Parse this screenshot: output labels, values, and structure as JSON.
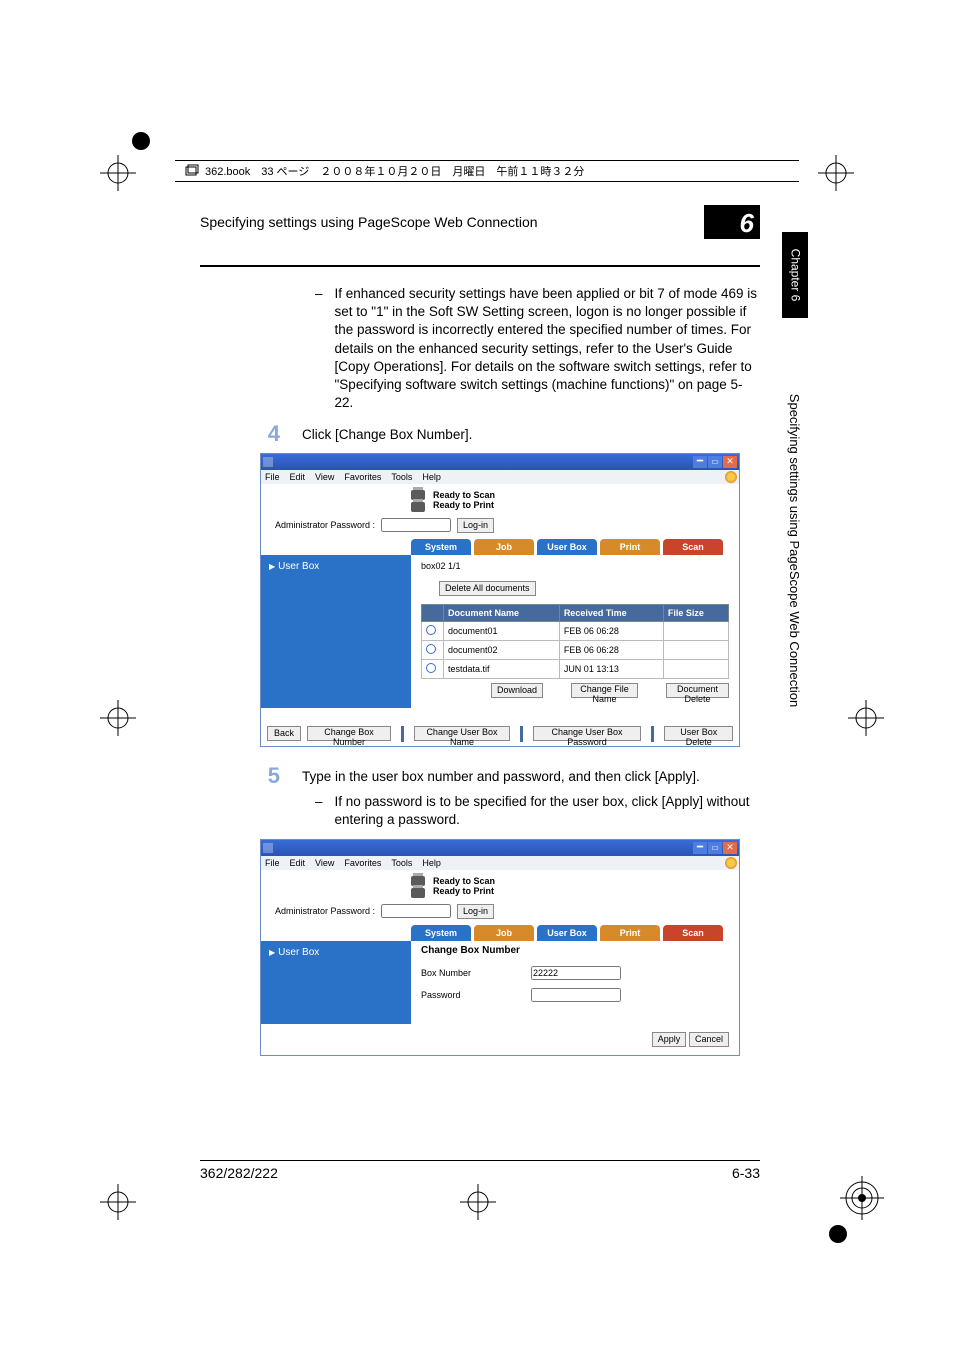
{
  "header_strip": "362.book　33 ページ　２００８年１０月２０日　月曜日　午前１１時３２分",
  "running_head": "Specifying settings using PageScope Web Connection",
  "chapter_number": "6",
  "side_chapter_label": "Chapter 6",
  "side_vertical_text": "Specifying settings using PageScope Web Connection",
  "para_bullet1": "If enhanced security settings have been applied or bit 7 of mode 469 is set to \"1\" in the Soft SW Setting screen, logon is no longer possible if the password is incorrectly entered the specified number of times. For details on the enhanced security settings, refer to the User's Guide [Copy Operations]. For details on the software switch settings, refer to \"Specifying software switch settings (machine functions)\" on page 5-22.",
  "step4_num": "4",
  "step4_text": "Click [Change Box Number].",
  "step5_num": "5",
  "step5_text": "Type in the user box number and password, and then click [Apply].",
  "step5_bullet": "If no password is to be specified for the user box, click [Apply] without entering a password.",
  "win": {
    "menus": [
      "File",
      "Edit",
      "View",
      "Favorites",
      "Tools",
      "Help"
    ],
    "status1": "Ready to Scan",
    "status2": "Ready to Print",
    "admin_label": "Administrator Password :",
    "login_btn": "Log-in",
    "tabs": {
      "system": "System",
      "job": "Job",
      "userbox": "User Box",
      "print": "Print",
      "scan": "Scan"
    },
    "sidebar_item": "User Box",
    "box_info": "box02  1/1",
    "delete_all_btn": "Delete All documents",
    "table": {
      "headers": [
        "",
        "Document Name",
        "Received Time",
        "File Size"
      ],
      "rows": [
        {
          "name": "document01",
          "time": "FEB 06 06:28",
          "size": ""
        },
        {
          "name": "document02",
          "time": "FEB 06 06:28",
          "size": ""
        },
        {
          "name": "testdata.tif",
          "time": "JUN 01 13:13",
          "size": ""
        }
      ]
    },
    "btn_download": "Download",
    "btn_change_file": "Change File Name",
    "btn_doc_delete": "Document Delete",
    "footer_btns": {
      "back": "Back",
      "change_box_number": "Change Box Number",
      "change_user_box_name": "Change User Box Name",
      "change_user_box_password": "Change User Box Password",
      "user_box_delete": "User Box Delete"
    }
  },
  "win2": {
    "form_title": "Change Box Number",
    "box_number_label": "Box Number",
    "box_number_value": "22222",
    "password_label": "Password",
    "apply": "Apply",
    "cancel": "Cancel"
  },
  "footer_left": "362/282/222",
  "footer_right": "6-33"
}
